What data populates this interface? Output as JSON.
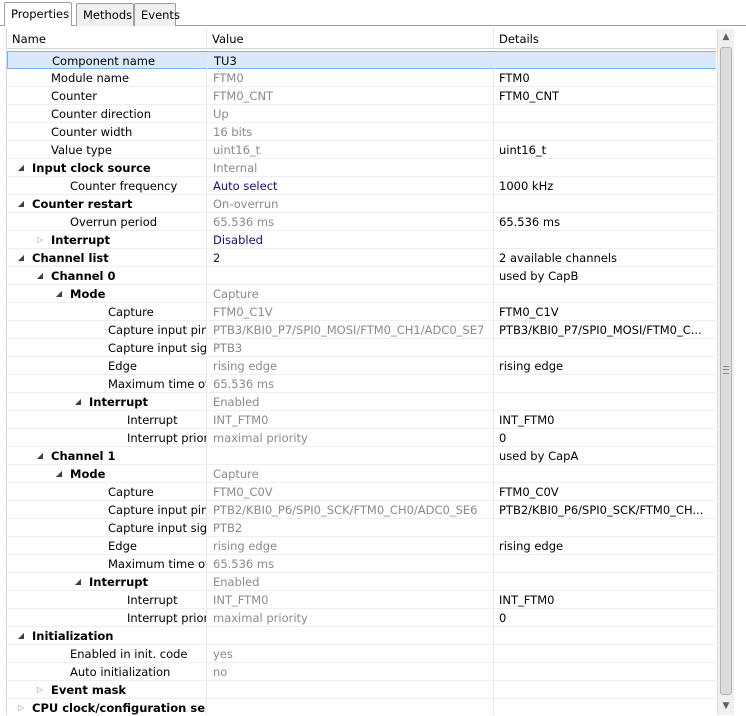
{
  "tabs": [
    {
      "label": "Properties",
      "active": true
    },
    {
      "label": "Methods",
      "active": false
    },
    {
      "label": "Events",
      "active": false
    }
  ],
  "columns": {
    "name": "Name",
    "value": "Value",
    "details": "Details"
  },
  "rows": [
    {
      "name": "Component name",
      "value": "TU3",
      "details": "",
      "indent": 1,
      "selected": true
    },
    {
      "name": "Module name",
      "value": "FTM0",
      "details": "FTM0",
      "indent": 1,
      "value_style": "grey"
    },
    {
      "name": "Counter",
      "value": "FTM0_CNT",
      "details": "FTM0_CNT",
      "indent": 1,
      "value_style": "grey"
    },
    {
      "name": "Counter direction",
      "value": "Up",
      "details": "",
      "indent": 1,
      "value_style": "grey"
    },
    {
      "name": "Counter width",
      "value": "16 bits",
      "details": "",
      "indent": 1,
      "value_style": "grey"
    },
    {
      "name": "Value type",
      "value": "uint16_t",
      "details": "uint16_t",
      "indent": 1,
      "value_style": "grey"
    },
    {
      "name": "Input clock source",
      "value": "Internal",
      "details": "",
      "indent": 0,
      "toggle": "expanded",
      "bold": true,
      "value_style": "grey"
    },
    {
      "name": "Counter frequency",
      "value": "Auto select",
      "details": "1000 kHz",
      "indent": 2,
      "value_style": "blue"
    },
    {
      "name": "Counter restart",
      "value": "On-overrun",
      "details": "",
      "indent": 0,
      "toggle": "expanded",
      "bold": true,
      "value_style": "grey"
    },
    {
      "name": "Overrun period",
      "value": "65.536 ms",
      "details": "65.536 ms",
      "indent": 2,
      "value_style": "grey"
    },
    {
      "name": "Interrupt",
      "value": "Disabled",
      "details": "",
      "indent": 1,
      "toggle": "collapsed",
      "bold": true,
      "value_style": "blue"
    },
    {
      "name": "Channel list",
      "value": "2",
      "details": "2 available channels",
      "indent": 0,
      "toggle": "expanded",
      "bold": true,
      "value_style": "blue"
    },
    {
      "name": "Channel 0",
      "value": "",
      "details": "used by CapB",
      "indent": 1,
      "toggle": "expanded",
      "bold": true
    },
    {
      "name": "Mode",
      "value": "Capture",
      "details": "",
      "indent": 2,
      "toggle": "expanded",
      "bold": true,
      "value_style": "grey"
    },
    {
      "name": "Capture",
      "value": "FTM0_C1V",
      "details": "FTM0_C1V",
      "indent": 4,
      "value_style": "grey"
    },
    {
      "name": "Capture input pin",
      "value": "PTB3/KBI0_P7/SPI0_MOSI/FTM0_CH1/ADC0_SE7",
      "details": "PTB3/KBI0_P7/SPI0_MOSI/FTM0_C...",
      "indent": 4,
      "value_style": "grey"
    },
    {
      "name": "Capture input signal",
      "value": "PTB3",
      "details": "",
      "indent": 4,
      "value_style": "grey"
    },
    {
      "name": "Edge",
      "value": "rising edge",
      "details": "rising edge",
      "indent": 4,
      "value_style": "grey"
    },
    {
      "name": "Maximum time of event",
      "value": "65.536 ms",
      "details": "",
      "indent": 4,
      "value_style": "grey"
    },
    {
      "name": "Interrupt",
      "value": "Enabled",
      "details": "",
      "indent": 3,
      "toggle": "expanded",
      "bold": true,
      "value_style": "grey"
    },
    {
      "name": "Interrupt",
      "value": "INT_FTM0",
      "details": "INT_FTM0",
      "indent": 5,
      "value_style": "grey"
    },
    {
      "name": "Interrupt priority",
      "value": "maximal priority",
      "details": "0",
      "indent": 5,
      "value_style": "grey"
    },
    {
      "name": "Channel 1",
      "value": "",
      "details": "used by CapA",
      "indent": 1,
      "toggle": "expanded",
      "bold": true
    },
    {
      "name": "Mode",
      "value": "Capture",
      "details": "",
      "indent": 2,
      "toggle": "expanded",
      "bold": true,
      "value_style": "grey"
    },
    {
      "name": "Capture",
      "value": "FTM0_C0V",
      "details": "FTM0_C0V",
      "indent": 4,
      "value_style": "grey"
    },
    {
      "name": "Capture input pin",
      "value": "PTB2/KBI0_P6/SPI0_SCK/FTM0_CH0/ADC0_SE6",
      "details": "PTB2/KBI0_P6/SPI0_SCK/FTM0_CH...",
      "indent": 4,
      "value_style": "grey"
    },
    {
      "name": "Capture input signal",
      "value": "PTB2",
      "details": "",
      "indent": 4,
      "value_style": "grey"
    },
    {
      "name": "Edge",
      "value": "rising edge",
      "details": "rising edge",
      "indent": 4,
      "value_style": "grey"
    },
    {
      "name": "Maximum time of event",
      "value": "65.536 ms",
      "details": "",
      "indent": 4,
      "value_style": "grey"
    },
    {
      "name": "Interrupt",
      "value": "Enabled",
      "details": "",
      "indent": 3,
      "toggle": "expanded",
      "bold": true,
      "value_style": "grey"
    },
    {
      "name": "Interrupt",
      "value": "INT_FTM0",
      "details": "INT_FTM0",
      "indent": 5,
      "value_style": "grey"
    },
    {
      "name": "Interrupt priority",
      "value": "maximal priority",
      "details": "0",
      "indent": 5,
      "value_style": "grey"
    },
    {
      "name": "Initialization",
      "value": "",
      "details": "",
      "indent": 0,
      "toggle": "expanded",
      "bold": true
    },
    {
      "name": "Enabled in init. code",
      "value": "yes",
      "details": "",
      "indent": 2,
      "value_style": "grey"
    },
    {
      "name": "Auto initialization",
      "value": "no",
      "details": "",
      "indent": 2,
      "value_style": "grey"
    },
    {
      "name": "Event mask",
      "value": "",
      "details": "",
      "indent": 1,
      "toggle": "collapsed",
      "bold": true
    },
    {
      "name": "CPU clock/configuration selection",
      "value": "",
      "details": "",
      "indent": 0,
      "toggle": "collapsed",
      "bold": true
    }
  ],
  "scrollbar": {
    "up_icon": "arrow-up-icon",
    "down_icon": "arrow-down-icon"
  }
}
